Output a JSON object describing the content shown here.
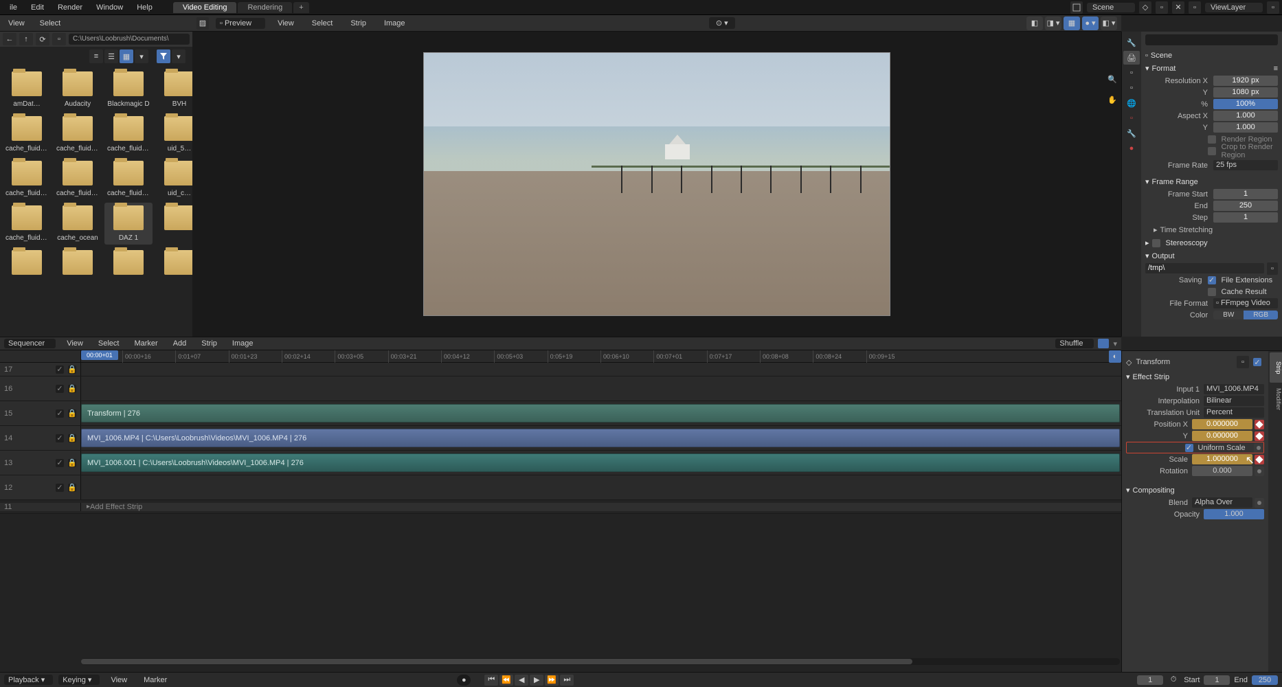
{
  "top_menu": {
    "file": "ile",
    "edit": "Edit",
    "render": "Render",
    "window": "Window",
    "help": "Help"
  },
  "workspaces": {
    "active": "Video Editing",
    "inactive": "Rendering",
    "add": "+"
  },
  "scene": {
    "label": "Scene",
    "layer": "ViewLayer"
  },
  "filebrowser": {
    "view": "View",
    "select": "Select",
    "path": "C:\\Users\\Loobrush\\Documents\\",
    "items": [
      {
        "label": "amDat…"
      },
      {
        "label": "Audacity"
      },
      {
        "label": "Blackmagic D"
      },
      {
        "label": "BVH"
      },
      {
        "label": "cache_fluid_3…"
      },
      {
        "label": "cache_fluid_4…"
      },
      {
        "label": "cache_fluid_5…"
      },
      {
        "label": "uid_5…"
      },
      {
        "label": "cache_fluid_8…"
      },
      {
        "label": "cache_fluid_2…"
      },
      {
        "label": "cache_fluid_a…"
      },
      {
        "label": "uid_c…"
      },
      {
        "label": "cache_fluid_c…"
      },
      {
        "label": "cache_ocean"
      },
      {
        "label": "DAZ 1",
        "sel": true
      },
      {
        "label": ""
      },
      {
        "label": ""
      },
      {
        "label": ""
      },
      {
        "label": ""
      },
      {
        "label": ""
      }
    ]
  },
  "preview_header": {
    "mode": "Preview",
    "view": "View",
    "select": "Select",
    "strip": "Strip",
    "image": "Image"
  },
  "props": {
    "scene_crumb": "Scene",
    "format": "Format",
    "res_x_lbl": "Resolution X",
    "res_x": "1920 px",
    "res_y_lbl": "Y",
    "res_y": "1080 px",
    "pct_lbl": "%",
    "pct": "100%",
    "asp_x_lbl": "Aspect X",
    "asp_x": "1.000",
    "asp_y_lbl": "Y",
    "asp_y": "1.000",
    "render_region": "Render Region",
    "crop": "Crop to Render Region",
    "framerate_lbl": "Frame Rate",
    "framerate": "25 fps",
    "frame_range": "Frame Range",
    "fstart_lbl": "Frame Start",
    "fstart": "1",
    "fend_lbl": "End",
    "fend": "250",
    "fstep_lbl": "Step",
    "fstep": "1",
    "time_stretch": "Time Stretching",
    "stereoscopy": "Stereoscopy",
    "output": "Output",
    "output_path": "/tmp\\",
    "saving_lbl": "Saving",
    "file_ext": "File Extensions",
    "cache_res": "Cache Result",
    "fileformat_lbl": "File Format",
    "fileformat": "FFmpeg Video",
    "color_lbl": "Color",
    "bw": "BW",
    "rgb": "RGB"
  },
  "sequencer": {
    "mode": "Sequencer",
    "view": "View",
    "select": "Select",
    "marker": "Marker",
    "add": "Add",
    "strip": "Strip",
    "image": "Image",
    "shuffle": "Shuffle",
    "playhead": "00:00+01",
    "ticks": [
      "00:00+16",
      "0:01+07",
      "00:01+23",
      "00:02+14",
      "00:03+05",
      "00:03+21",
      "00:04+12",
      "00:05+03",
      "0:05+19",
      "00:06+10",
      "00:07+01",
      "0:07+17",
      "00:08+08",
      "00:08+24",
      "00:09+15"
    ],
    "channels": [
      "17",
      "16",
      "15",
      "14",
      "13",
      "12",
      "11"
    ],
    "strip_transform": "Transform | 276",
    "strip_video": "MVI_1006.MP4 | C:\\Users\\Loobrush\\Videos\\MVI_1006.MP4 | 276",
    "strip_audio": "MVI_1006.001 | C:\\Users\\Loobrush\\Videos\\MVI_1006.MP4 | 276",
    "add_effect": "Add Effect Strip"
  },
  "playbar": {
    "playback": "Playback",
    "keying": "Keying",
    "view": "View",
    "marker": "Marker",
    "frame": "1",
    "start_lbl": "Start",
    "start": "1",
    "end_lbl": "End",
    "end": "250"
  },
  "strip_panel": {
    "title": "Transform",
    "effect_strip": "Effect Strip",
    "input1_lbl": "Input 1",
    "input1": "MVI_1006.MP4",
    "interp_lbl": "Interpolation",
    "interp": "Bilinear",
    "tunit_lbl": "Translation Unit",
    "tunit": "Percent",
    "posx_lbl": "Position X",
    "posx": "0.000000",
    "posy_lbl": "Y",
    "posy": "0.000000",
    "uniform": "Uniform Scale",
    "scale_lbl": "Scale",
    "scale": "1.000000",
    "rot_lbl": "Rotation",
    "rot": "0.000",
    "compositing": "Compositing",
    "blend_lbl": "Blend",
    "blend": "Alpha Over",
    "opacity_lbl": "Opacity",
    "opacity": "1.000",
    "tab_strip": "Strip",
    "tab_mod": "Modifier"
  }
}
